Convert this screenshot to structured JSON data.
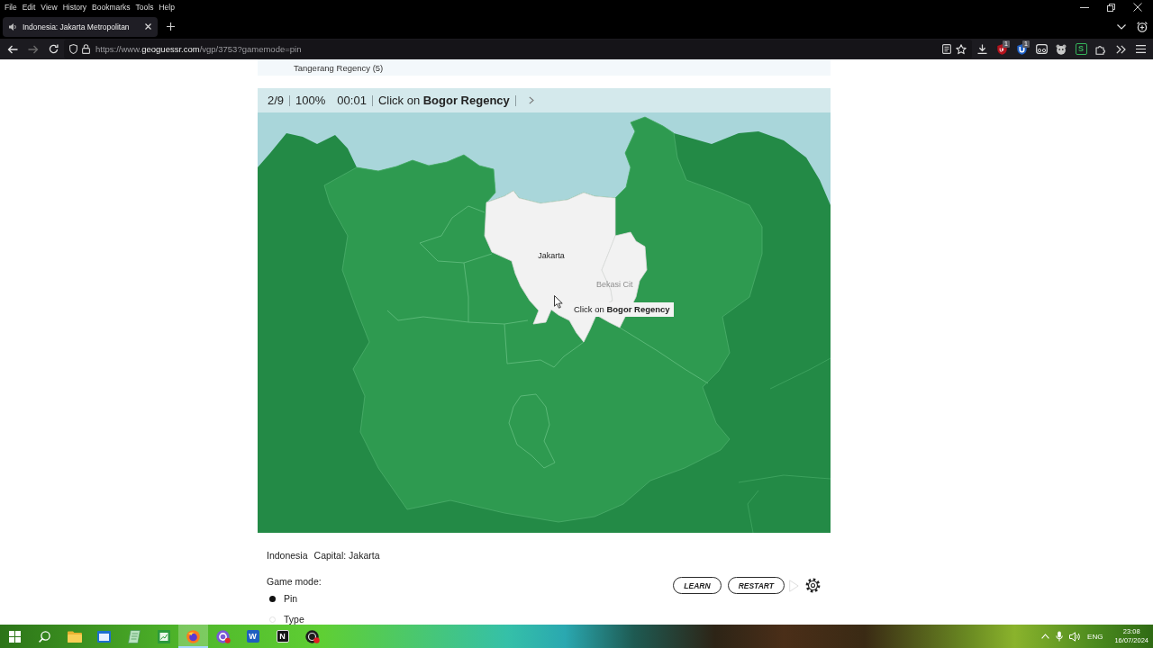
{
  "browser": {
    "menu": [
      "File",
      "Edit",
      "View",
      "History",
      "Bookmarks",
      "Tools",
      "Help"
    ],
    "tabs": [
      {
        "title": "Indonesia: Jakarta Metropolitan",
        "selected": true
      }
    ],
    "url": {
      "scheme": "https://www.",
      "domain": "geoguessr.com",
      "path": "/vgp/3753?gamemode=pin"
    },
    "extensions": [
      {
        "kind": "shield",
        "badge": "1"
      },
      {
        "kind": "ushield",
        "badge": "1"
      },
      {
        "kind": "cassette"
      },
      {
        "kind": "paw"
      },
      {
        "kind": "letter",
        "label": "S"
      }
    ]
  },
  "page": {
    "list_item": "Tangerang Regency (5)",
    "game": {
      "progress": "2/9",
      "score": "100%",
      "timer": "00:01",
      "prompt": "Click on **Bogor Regency**"
    },
    "map": {
      "labels": [
        {
          "text": "Jakarta",
          "kind": "region"
        },
        {
          "text": "Bekasi Cit",
          "kind": "faded"
        }
      ],
      "tooltip": "Click on **Bogor Regency**"
    },
    "country": "Indonesia",
    "capital": "Capital: Jakarta",
    "game_mode": {
      "label": "Game mode:",
      "options": [
        {
          "label": "Pin",
          "selected": true
        },
        {
          "label": "Type",
          "selected": false
        }
      ]
    },
    "buttons": [
      "LEARN",
      "RESTART"
    ],
    "play": {
      "disabled": true
    }
  },
  "taskbar": {
    "apps": [
      {
        "kind": "folder",
        "selected": false
      },
      {
        "kind": "window",
        "selected": false
      },
      {
        "kind": "note",
        "selected": false
      },
      {
        "kind": "sheet",
        "selected": false
      },
      {
        "kind": "browser",
        "selected": true
      },
      {
        "kind": "chat",
        "selected": false
      },
      {
        "kind": "doc",
        "label": "W",
        "selected": false
      },
      {
        "kind": "notes",
        "label": "N",
        "selected": false
      },
      {
        "kind": "record",
        "selected": false
      }
    ],
    "tray": {
      "language": "ENG",
      "time": "23:08",
      "date": "16/07/2024"
    }
  }
}
